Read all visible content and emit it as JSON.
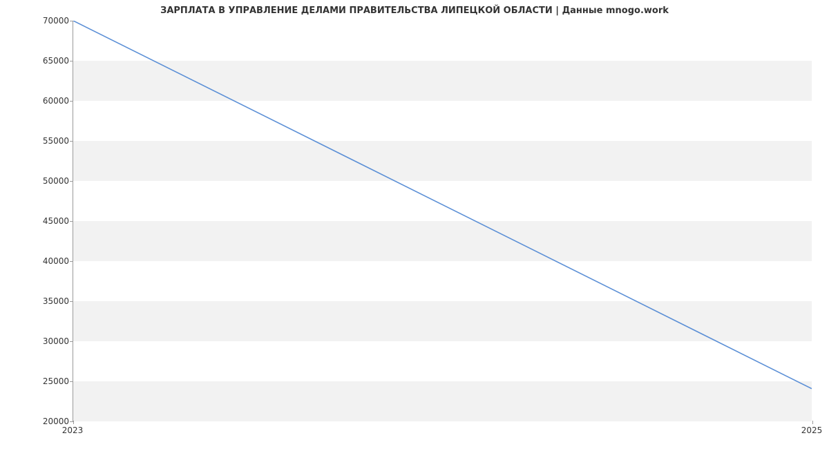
{
  "chart_data": {
    "type": "line",
    "title": "ЗАРПЛАТА В УПРАВЛЕНИЕ ДЕЛАМИ ПРАВИТЕЛЬСТВА ЛИПЕЦКОЙ ОБЛАСТИ | Данные mnogo.work",
    "x": [
      2023,
      2025
    ],
    "values": [
      70000,
      24000
    ],
    "xlabel": "",
    "ylabel": "",
    "xlim": [
      2023,
      2025
    ],
    "ylim": [
      20000,
      70000
    ],
    "y_ticks": [
      20000,
      25000,
      30000,
      35000,
      40000,
      45000,
      50000,
      55000,
      60000,
      65000,
      70000
    ],
    "x_ticks": [
      2023,
      2025
    ],
    "line_color": "#5b8fd6",
    "grid": true
  }
}
